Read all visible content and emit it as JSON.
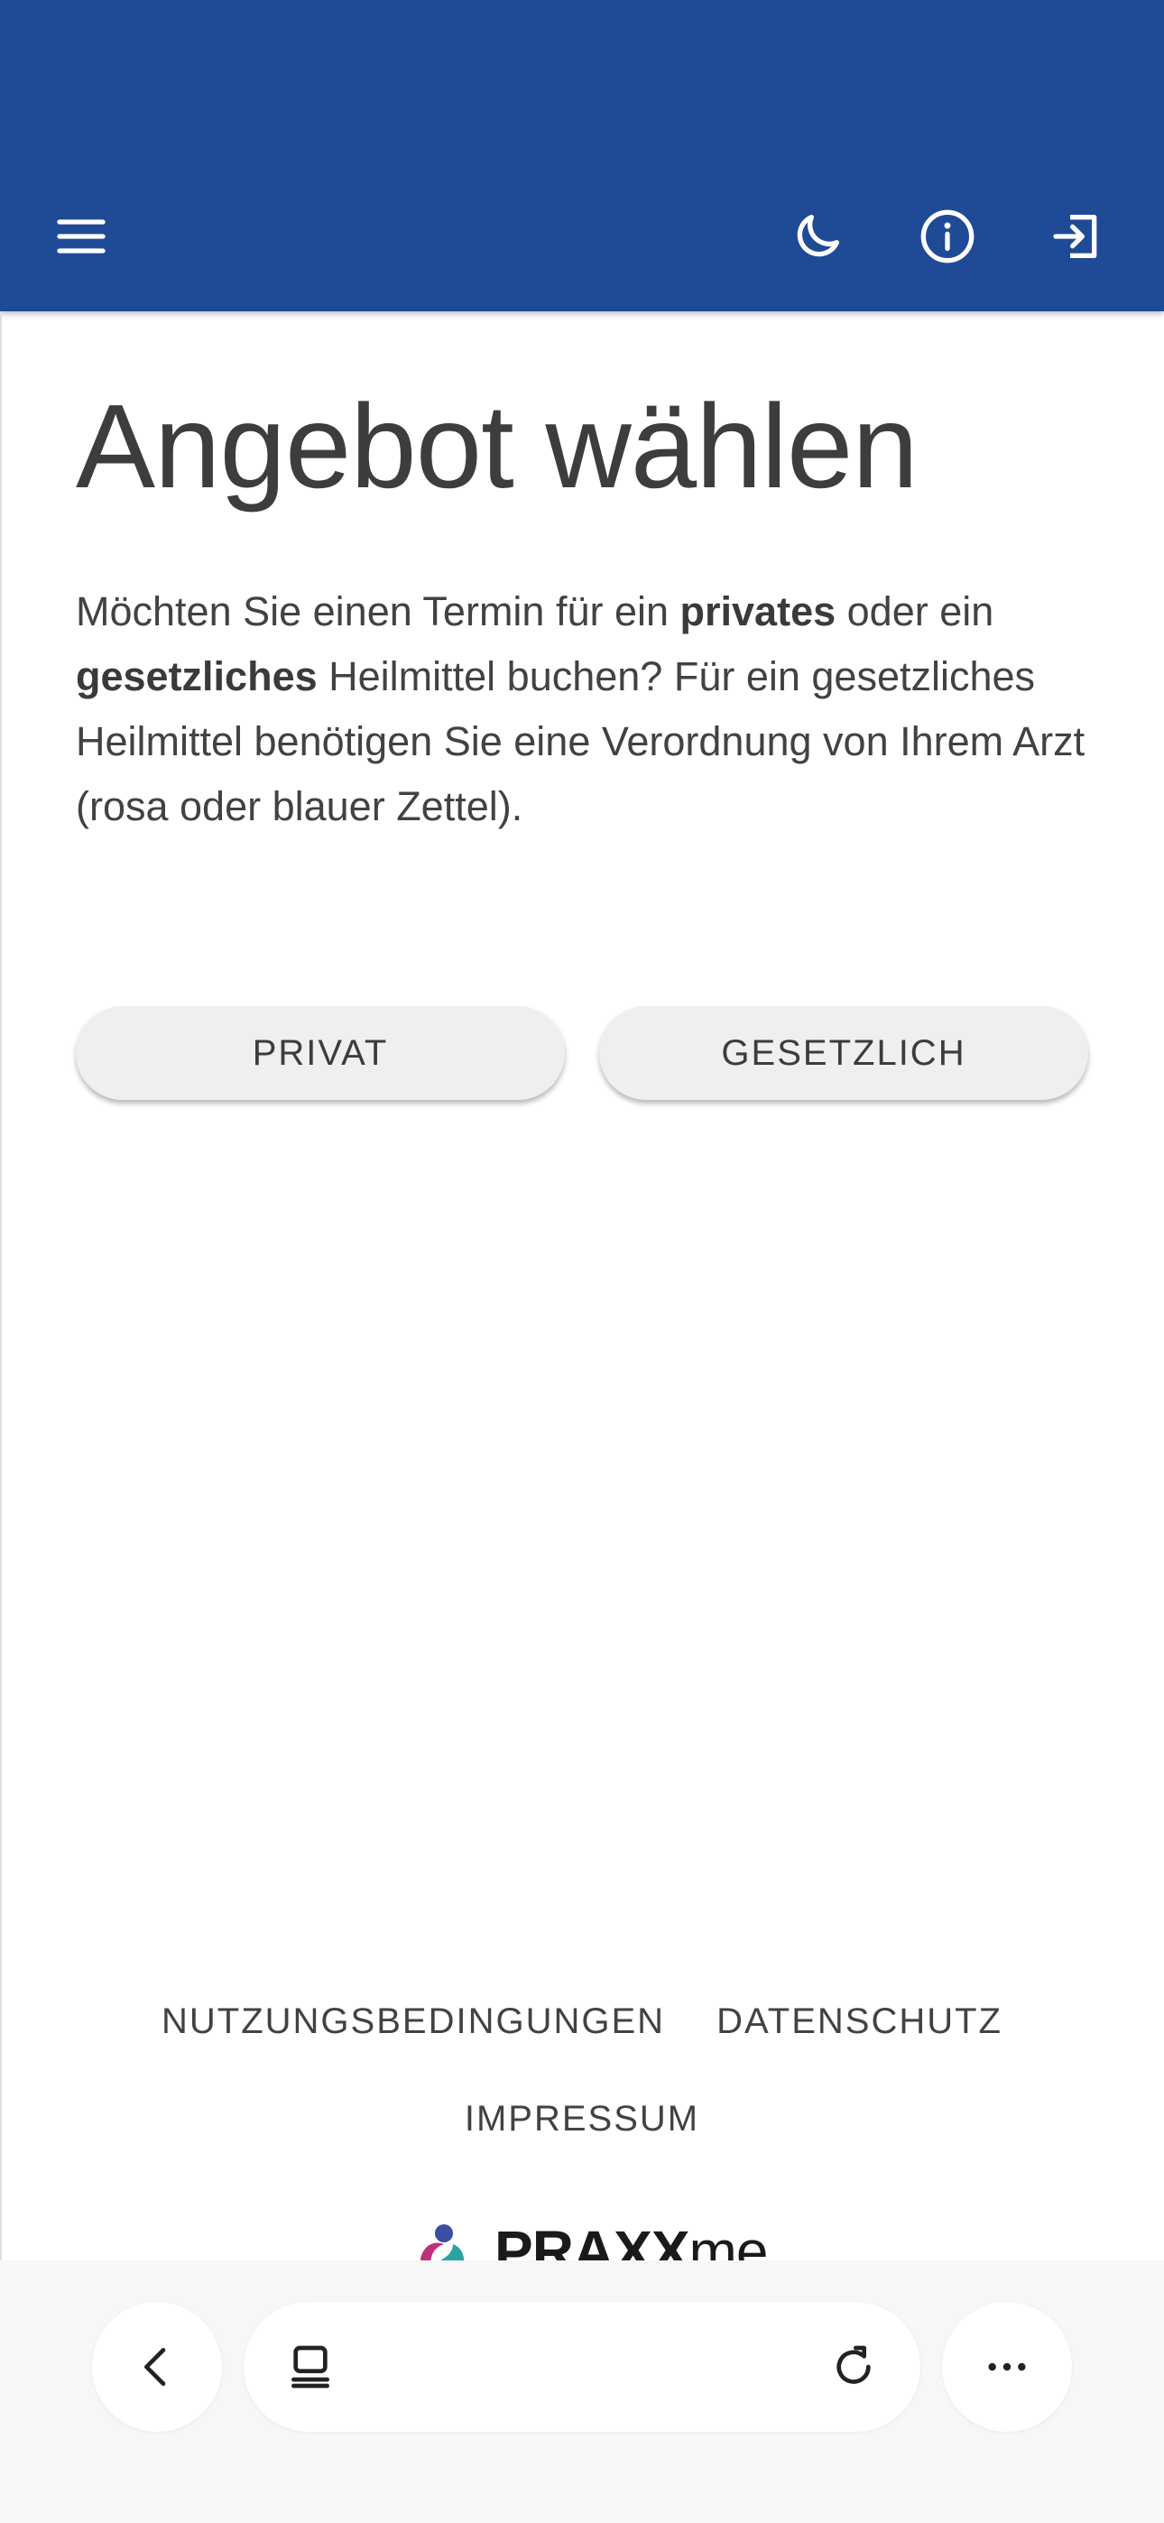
{
  "appbar": {
    "color": "#1f4a96",
    "icons": [
      "menu-icon",
      "moon-icon",
      "info-icon",
      "logout-icon"
    ]
  },
  "page": {
    "title": "Angebot wählen",
    "intro": {
      "p1": "Möchten Sie einen Termin für ein ",
      "b1": "privates",
      "p2": " oder ein ",
      "b2": "gesetzliches",
      "p3": " Heilmittel buchen? Für ein gesetzliches Heilmittel benötigen Sie eine Verordnung von Ihrem Arzt (rosa oder blauer Zettel)."
    },
    "buttons": {
      "private": "PRIVAT",
      "statutory": "GESETZLICH"
    }
  },
  "footer": {
    "terms": "NUTZUNGSBEDINGUNGEN",
    "privacy": "DATENSCHUTZ",
    "imprint": "IMPRESSUM",
    "logo_text_a": "PRAXX",
    "logo_text_b": "me"
  },
  "browser_bar": {
    "icons": [
      "back-icon",
      "tabs-icon",
      "reload-icon",
      "more-icon"
    ]
  }
}
